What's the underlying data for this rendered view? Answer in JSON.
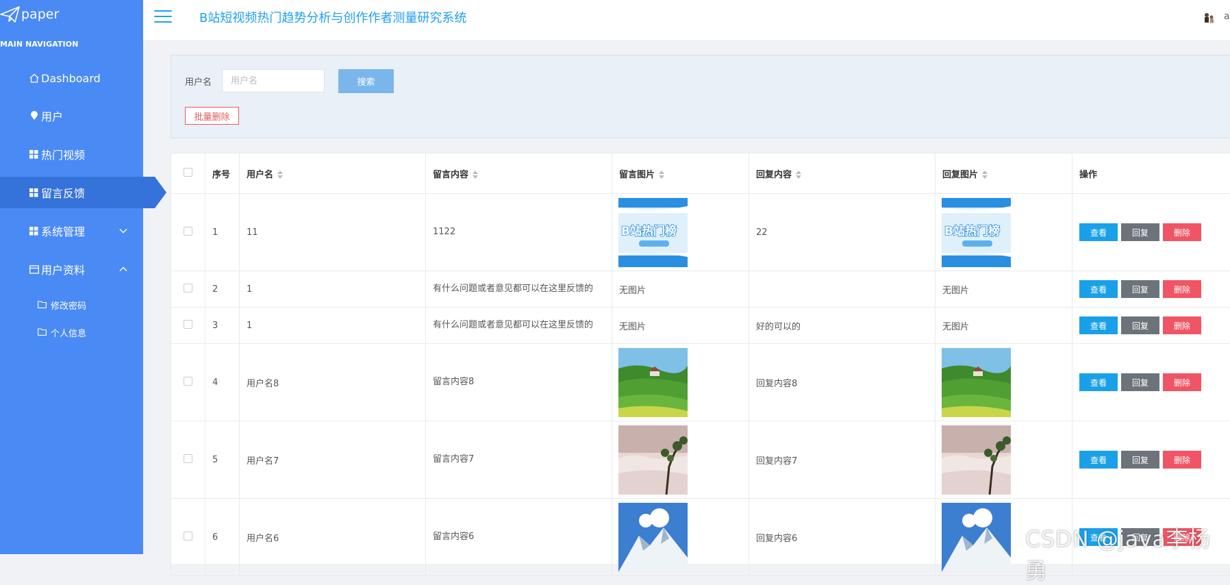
{
  "sidebar": {
    "logo_text": "paper",
    "heading": "MAIN NAVIGATION",
    "items": [
      {
        "label": "Dashboard",
        "icon": "home-icon"
      },
      {
        "label": "用户",
        "icon": "pin-icon"
      },
      {
        "label": "热门视频",
        "icon": "grid-icon"
      },
      {
        "label": "留言反馈",
        "icon": "grid-icon"
      },
      {
        "label": "系统管理",
        "icon": "grid-icon"
      },
      {
        "label": "用户资料",
        "icon": "card-icon"
      }
    ],
    "subitems": [
      {
        "label": "修改密码",
        "icon": "folder-icon"
      },
      {
        "label": "个人信息",
        "icon": "folder-icon"
      }
    ]
  },
  "header": {
    "title": "B站短视频热门趋势分析与创作作者测量研究系统",
    "user_trunc": "ad"
  },
  "search": {
    "label": "用户名",
    "placeholder": "用户名",
    "value": "",
    "search_button": "搜索",
    "batch_delete_button": "批量删除"
  },
  "table": {
    "columns": [
      "序号",
      "用户名",
      "留言内容",
      "留言图片",
      "回复内容",
      "回复图片",
      "操作"
    ],
    "actions": {
      "view": "查看",
      "reply": "回复",
      "delete": "删除"
    },
    "rows": [
      {
        "index": "1",
        "username": "11",
        "content": "1122",
        "image": "bilibili-banner",
        "reply": "22",
        "reply_image": "bilibili-banner"
      },
      {
        "index": "2",
        "username": "1",
        "content": "有什么问题或者意见都可以在这里反馈的",
        "image": "无图片",
        "reply": "",
        "reply_image": "无图片"
      },
      {
        "index": "3",
        "username": "1",
        "content": "有什么问题或者意见都可以在这里反馈的",
        "image": "无图片",
        "reply": "好的可以的",
        "reply_image": "无图片"
      },
      {
        "index": "4",
        "username": "用户名8",
        "content": "留言内容8",
        "image": "green-hills",
        "reply": "回复内容8",
        "reply_image": "green-hills"
      },
      {
        "index": "5",
        "username": "用户名7",
        "content": "留言内容7",
        "image": "misty-pine",
        "reply": "回复内容7",
        "reply_image": "misty-pine"
      },
      {
        "index": "6",
        "username": "用户名6",
        "content": "留言内容6",
        "image": "snow-mountain",
        "reply": "回复内容6",
        "reply_image": "snow-mountain"
      }
    ],
    "banner_text": "B站热门榜"
  },
  "watermark": "CSDN @java李杨勇",
  "colors": {
    "sidebar": "#4a8af4",
    "sidebar_active": "#3572d9",
    "accent": "#1e9ff2",
    "view_button": "#1aa0e8",
    "reply_button": "#6c737a",
    "delete_button": "#ef5565"
  }
}
